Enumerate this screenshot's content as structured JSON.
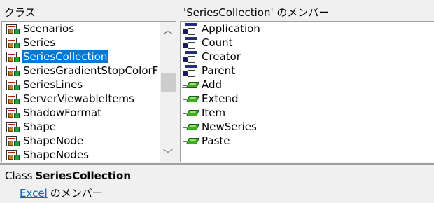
{
  "classes_header": "クラス",
  "members_header": "'SeriesCollection' のメンバー",
  "classes": [
    {
      "label": "Scenarios",
      "selected": false
    },
    {
      "label": "Series",
      "selected": false
    },
    {
      "label": "SeriesCollection",
      "selected": true
    },
    {
      "label": "SeriesGradientStopColorF",
      "selected": false
    },
    {
      "label": "SeriesLines",
      "selected": false
    },
    {
      "label": "ServerViewableItems",
      "selected": false
    },
    {
      "label": "ShadowFormat",
      "selected": false
    },
    {
      "label": "Shape",
      "selected": false
    },
    {
      "label": "ShapeNode",
      "selected": false
    },
    {
      "label": "ShapeNodes",
      "selected": false
    }
  ],
  "members": [
    {
      "label": "Application",
      "kind": "property"
    },
    {
      "label": "Count",
      "kind": "property"
    },
    {
      "label": "Creator",
      "kind": "property"
    },
    {
      "label": "Parent",
      "kind": "property"
    },
    {
      "label": "Add",
      "kind": "method"
    },
    {
      "label": "Extend",
      "kind": "method"
    },
    {
      "label": "Item",
      "kind": "method"
    },
    {
      "label": "NewSeries",
      "kind": "method"
    },
    {
      "label": "Paste",
      "kind": "method"
    }
  ],
  "scrollbar": {
    "up_icon": "chevron-up-icon",
    "down_icon": "chevron-down-icon",
    "up_glyph": "︿",
    "down_glyph": "﹀"
  },
  "detail": {
    "kind": "Class",
    "name": "SeriesCollection",
    "library_link": "Excel",
    "member_of": "のメンバー"
  },
  "colors": {
    "selection": "#0078d7",
    "link": "#1a5fb4",
    "method_green": "#3cb021"
  }
}
